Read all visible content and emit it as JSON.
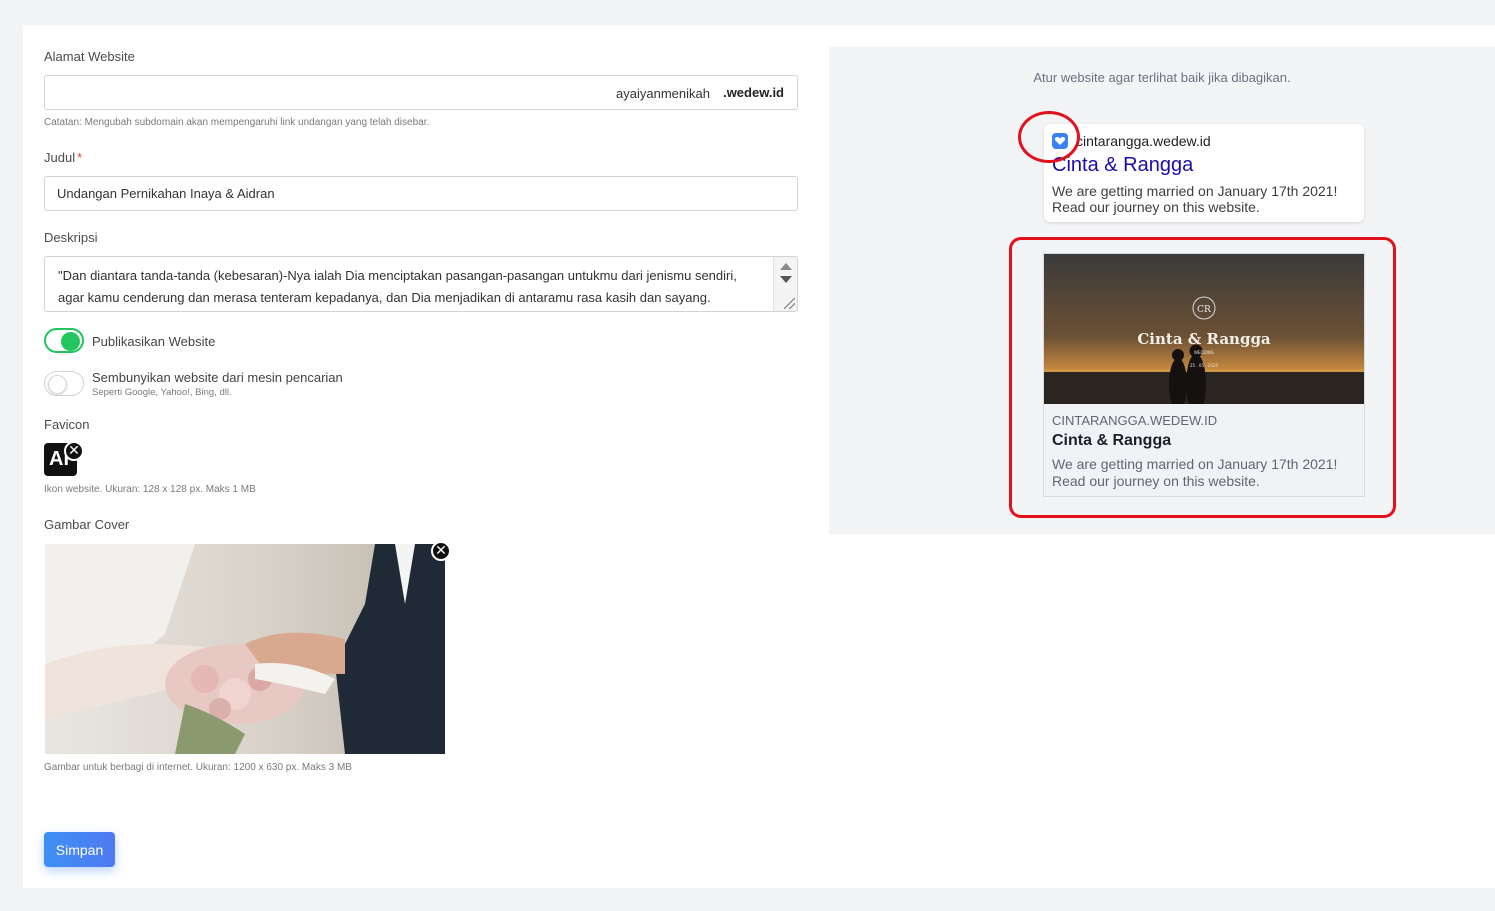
{
  "form": {
    "address": {
      "label": "Alamat Website",
      "subdomain": "ayaiyanmenikah",
      "suffix": ".wedew.id",
      "note": "Catatan: Mengubah subdomain akan mempengaruhi link undangan yang telah disebar."
    },
    "title": {
      "label": "Judul",
      "required_mark": "*",
      "value": "Undangan Pernikahan Inaya & Aidran"
    },
    "description": {
      "label": "Deskripsi",
      "line1": "\"Dan diantara tanda-tanda (kebesaran)-Nya ialah Dia menciptakan pasangan-pasangan untukmu dari jenismu sendiri,",
      "line2": "agar kamu cenderung dan merasa tenteram kepadanya, dan Dia menjadikan di antaramu rasa kasih dan sayang."
    },
    "publish": {
      "label": "Publikasikan Website",
      "on": true
    },
    "hide_search": {
      "label": "Sembunyikan website dari mesin pencarian",
      "sublabel": "Seperti Google, Yahoo!, Bing, dll.",
      "on": false
    },
    "favicon": {
      "label": "Favicon",
      "icon_text": "AI",
      "note": "Ikon website. Ukuran: 128 x 128 px. Maks 1 MB"
    },
    "cover": {
      "label": "Gambar Cover",
      "note": "Gambar untuk berbagi di internet. Ukuran: 1200 x 630 px. Maks 3 MB"
    },
    "remove_glyph": "✕",
    "save_label": "Simpan"
  },
  "preview": {
    "hint": "Atur website agar terlihat baik jika dibagikan.",
    "search": {
      "domain": "cintarangga.wedew.id",
      "title": "Cinta & Rangga",
      "description": "We are getting married on January 17th 2021! Read our journey on this website."
    },
    "social": {
      "image_monogram": "CR",
      "image_title": "Cinta & Rangga",
      "image_sub": "WEDDING",
      "image_date": "25 . 05 . 2020",
      "domain": "CINTARANGGA.WEDEW.ID",
      "title": "Cinta & Rangga",
      "description": "We are getting married on January 17th 2021! Read our journey on this website."
    }
  },
  "colors": {
    "toggle_on": "#22c55e",
    "button": "#3e8ff5",
    "highlight": "#e3101e",
    "search_title": "#1a0dab"
  }
}
